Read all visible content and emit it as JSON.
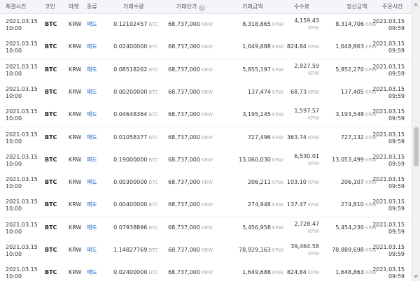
{
  "header": {
    "time": "체결시간",
    "coin": "코인",
    "market": "마켓",
    "side": "종류",
    "qty": "거래수량",
    "price": "거래단가",
    "price_help": "?",
    "amount": "거래금액",
    "fee": "수수료",
    "settle": "정산금액",
    "order_time": "주문시간"
  },
  "units": {
    "btc": "BTC",
    "krw": "KRW"
  },
  "rows": [
    {
      "date": "2021.03.15",
      "time": "10:00",
      "coin": "BTC",
      "market": "KRW",
      "side": "매도",
      "qty": "0.12102457",
      "price": "68,737,000",
      "amount": "8,318,865",
      "fee": "4,159.43",
      "settle": "8,314,706",
      "odate": "2021.03.15",
      "otime": "09:59"
    },
    {
      "date": "2021.03.15",
      "time": "10:00",
      "coin": "BTC",
      "market": "KRW",
      "side": "매도",
      "qty": "0.02400000",
      "price": "68,737,000",
      "amount": "1,649,688",
      "fee": "824.84",
      "settle": "1,648,863",
      "odate": "2021.03.15",
      "otime": "09:59"
    },
    {
      "date": "2021.03.15",
      "time": "10:00",
      "coin": "BTC",
      "market": "KRW",
      "side": "매도",
      "qty": "0.08518262",
      "price": "68,737,000",
      "amount": "5,855,197",
      "fee": "2,927.59",
      "settle": "5,852,270",
      "odate": "2021.03.15",
      "otime": "09:59"
    },
    {
      "date": "2021.03.15",
      "time": "10:00",
      "coin": "BTC",
      "market": "KRW",
      "side": "매도",
      "qty": "0.00200000",
      "price": "68,737,000",
      "amount": "137,474",
      "fee": "68.73",
      "settle": "137,405",
      "odate": "2021.03.15",
      "otime": "09:59"
    },
    {
      "date": "2021.03.15",
      "time": "10:00",
      "coin": "BTC",
      "market": "KRW",
      "side": "매도",
      "qty": "0.04648364",
      "price": "68,737,000",
      "amount": "3,195,145",
      "fee": "1,597.57",
      "settle": "3,193,548",
      "odate": "2021.03.15",
      "otime": "09:59"
    },
    {
      "date": "2021.03.15",
      "time": "10:00",
      "coin": "BTC",
      "market": "KRW",
      "side": "매도",
      "qty": "0.01058377",
      "price": "68,737,000",
      "amount": "727,496",
      "fee": "363.74",
      "settle": "727,132",
      "odate": "2021.03.15",
      "otime": "09:59"
    },
    {
      "date": "2021.03.15",
      "time": "10:00",
      "coin": "BTC",
      "market": "KRW",
      "side": "매도",
      "qty": "0.19000000",
      "price": "68,737,000",
      "amount": "13,060,030",
      "fee": "6,530.01",
      "settle": "13,053,499",
      "odate": "2021.03.15",
      "otime": "09:59"
    },
    {
      "date": "2021.03.15",
      "time": "10:00",
      "coin": "BTC",
      "market": "KRW",
      "side": "매도",
      "qty": "0.00300000",
      "price": "68,737,000",
      "amount": "206,211",
      "fee": "103.10",
      "settle": "206,107",
      "odate": "2021.03.15",
      "otime": "09:59"
    },
    {
      "date": "2021.03.15",
      "time": "10:00",
      "coin": "BTC",
      "market": "KRW",
      "side": "매도",
      "qty": "0.00400000",
      "price": "68,737,000",
      "amount": "274,948",
      "fee": "137.47",
      "settle": "274,810",
      "odate": "2021.03.15",
      "otime": "09:59"
    },
    {
      "date": "2021.03.15",
      "time": "10:00",
      "coin": "BTC",
      "market": "KRW",
      "side": "매도",
      "qty": "0.07938896",
      "price": "68,737,000",
      "amount": "5,456,958",
      "fee": "2,728.47",
      "settle": "5,454,230",
      "odate": "2021.03.15",
      "otime": "09:59"
    },
    {
      "date": "2021.03.15",
      "time": "10:00",
      "coin": "BTC",
      "market": "KRW",
      "side": "매도",
      "qty": "1.14827769",
      "price": "68,737,000",
      "amount": "78,929,163",
      "fee": "39,464.58",
      "settle": "78,889,698",
      "odate": "2021.03.15",
      "otime": "09:59"
    },
    {
      "date": "2021.03.15",
      "time": "10:00",
      "coin": "BTC",
      "market": "KRW",
      "side": "매도",
      "qty": "0.02400000",
      "price": "68,737,000",
      "amount": "1,649,688",
      "fee": "824.84",
      "settle": "1,648,863",
      "odate": "2021.03.15",
      "otime": "09:59"
    }
  ],
  "colors": {
    "sell": "#1261c4",
    "header_bg": "#f4f5f8"
  }
}
